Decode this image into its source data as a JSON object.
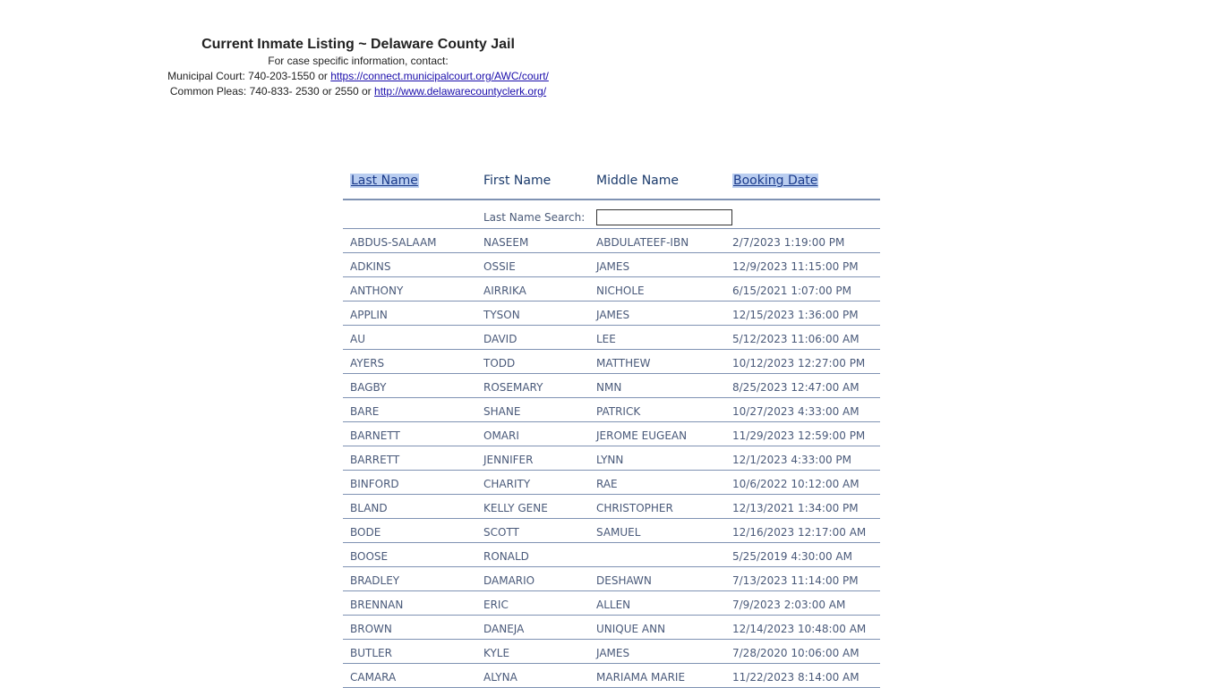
{
  "header": {
    "title": "Current Inmate Listing ~ Delaware County Jail",
    "contact_line": "For case specific information, contact:",
    "municipal_prefix": "Municipal Court: 740-203-1550 or ",
    "municipal_link": "https://connect.municipalcourt.org/AWC/court/",
    "common_prefix": "Common Pleas: 740-833- 2530 or 2550 or ",
    "common_link": "http://www.delawarecountyclerk.org/"
  },
  "table": {
    "columns": {
      "last_name": "Last Name",
      "first_name": "First Name",
      "middle_name": "Middle Name",
      "booking_date": "Booking Date"
    },
    "search_label": "Last Name Search:",
    "search_value": "",
    "rows": [
      [
        "ABDUS-SALAAM",
        "NASEEM",
        "ABDULATEEF-IBN",
        "2/7/2023 1:19:00 PM"
      ],
      [
        "ADKINS",
        "OSSIE",
        "JAMES",
        "12/9/2023 11:15:00 PM"
      ],
      [
        "ANTHONY",
        "AIRRIKA",
        "NICHOLE",
        "6/15/2021 1:07:00 PM"
      ],
      [
        "APPLIN",
        "TYSON",
        "JAMES",
        "12/15/2023 1:36:00 PM"
      ],
      [
        "AU",
        "DAVID",
        "LEE",
        "5/12/2023 11:06:00 AM"
      ],
      [
        "AYERS",
        "TODD",
        "MATTHEW",
        "10/12/2023 12:27:00 PM"
      ],
      [
        "BAGBY",
        "ROSEMARY",
        "NMN",
        "8/25/2023 12:47:00 AM"
      ],
      [
        "BARE",
        "SHANE",
        "PATRICK",
        "10/27/2023 4:33:00 AM"
      ],
      [
        "BARNETT",
        "OMARI",
        "JEROME EUGEAN",
        "11/29/2023 12:59:00 PM"
      ],
      [
        "BARRETT",
        "JENNIFER",
        "LYNN",
        "12/1/2023 4:33:00 PM"
      ],
      [
        "BINFORD",
        "CHARITY",
        "RAE",
        "10/6/2022 10:12:00 AM"
      ],
      [
        "BLAND",
        "KELLY GENE",
        "CHRISTOPHER",
        "12/13/2021 1:34:00 PM"
      ],
      [
        "BODE",
        "SCOTT",
        "SAMUEL",
        "12/16/2023 12:17:00 AM"
      ],
      [
        "BOOSE",
        "RONALD",
        "",
        "5/25/2019 4:30:00 AM"
      ],
      [
        "BRADLEY",
        "DAMARIO",
        "DESHAWN",
        "7/13/2023 11:14:00 PM"
      ],
      [
        "BRENNAN",
        "ERIC",
        "ALLEN",
        "7/9/2023 2:03:00 AM"
      ],
      [
        "BROWN",
        "DANEJA",
        "UNIQUE ANN",
        "12/14/2023 10:48:00 AM"
      ],
      [
        "BUTLER",
        "KYLE",
        "JAMES",
        "7/28/2020 10:06:00 AM"
      ],
      [
        "CAMARA",
        "ALYNA",
        "MARIAMA MARIE",
        "11/22/2023 8:14:00 AM"
      ]
    ]
  }
}
